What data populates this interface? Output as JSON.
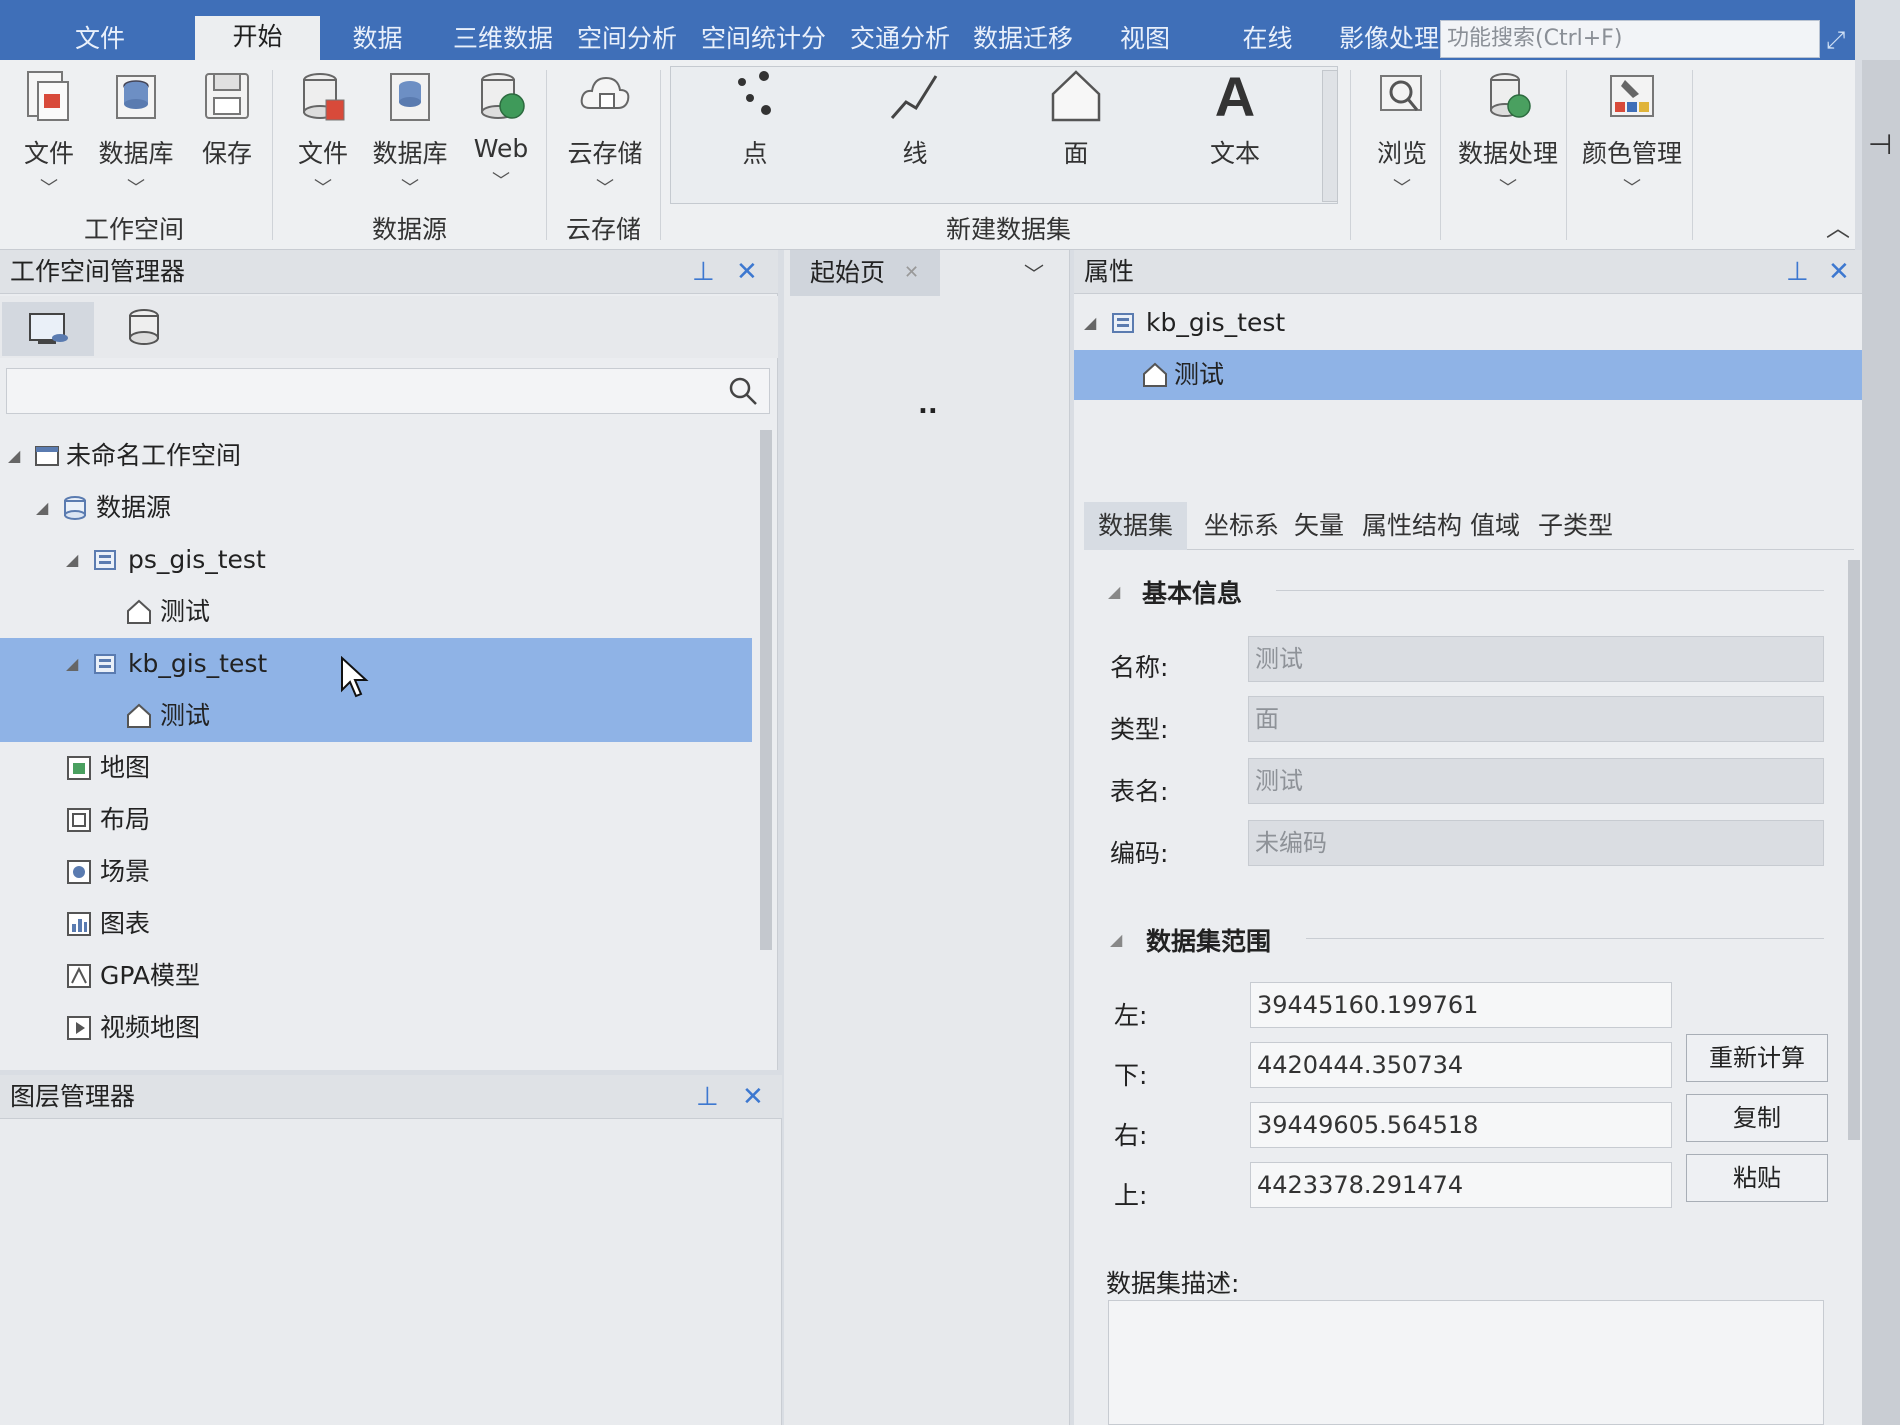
{
  "menu": {
    "tabs": [
      "文件",
      "开始",
      "数据",
      "三维数据",
      "空间分析",
      "空间统计分",
      "交通分析",
      "数据迁移",
      "视图",
      "在线",
      "影像处理"
    ],
    "active": "开始",
    "search_placeholder": "功能搜索(Ctrl+F)"
  },
  "ribbon": {
    "workspace": {
      "group": "工作空间",
      "file": "文件",
      "database": "数据库",
      "save": "保存"
    },
    "datasource": {
      "group": "数据源",
      "file": "文件",
      "database": "数据库",
      "web": "Web"
    },
    "cloud": {
      "group": "云存储",
      "cloud": "云存储"
    },
    "new_dataset": {
      "group": "新建数据集",
      "point": "点",
      "line": "线",
      "region": "面",
      "text": "文本"
    },
    "tools": {
      "browse": "浏览",
      "data_processing": "数据处理",
      "color_management": "颜色管理"
    }
  },
  "workspace_manager": {
    "title": "工作空间管理器",
    "tree": {
      "workspace": "未命名工作空间",
      "datasources": "数据源",
      "ds1": "ps_gis_test",
      "ds1_dataset": "测试",
      "ds2": "kb_gis_test",
      "ds2_dataset": "测试",
      "maps": "地图",
      "layouts": "布局",
      "scenes": "场景",
      "charts": "图表",
      "gpa": "GPA模型",
      "video_maps": "视频地图"
    }
  },
  "layer_manager": {
    "title": "图层管理器"
  },
  "start_page": {
    "tab": "起始页",
    "content": ".."
  },
  "properties": {
    "title": "属性",
    "tree": {
      "datasource": "kb_gis_test",
      "dataset": "测试"
    },
    "tabs": [
      "数据集",
      "坐标系",
      "矢量",
      "属性结构",
      "值域",
      "子类型"
    ],
    "active_tab": "数据集",
    "basic_info": {
      "section": "基本信息",
      "name_label": "名称:",
      "name_value": "测试",
      "type_label": "类型:",
      "type_value": "面",
      "table_label": "表名:",
      "table_value": "测试",
      "encoding_label": "编码:",
      "encoding_value": "未编码"
    },
    "bounds": {
      "section": "数据集范围",
      "left_label": "左:",
      "left_value": "39445160.199761",
      "bottom_label": "下:",
      "bottom_value": "4420444.350734",
      "right_label": "右:",
      "right_value": "39449605.564518",
      "top_label": "上:",
      "top_value": "4423378.291474",
      "recalc": "重新计算",
      "copy": "复制",
      "paste": "粘贴"
    },
    "description_label": "数据集描述:"
  },
  "colors": {
    "accent": "#3f6fb8",
    "selection": "#8fb3e6",
    "tool_icon": "#3d78d0"
  }
}
